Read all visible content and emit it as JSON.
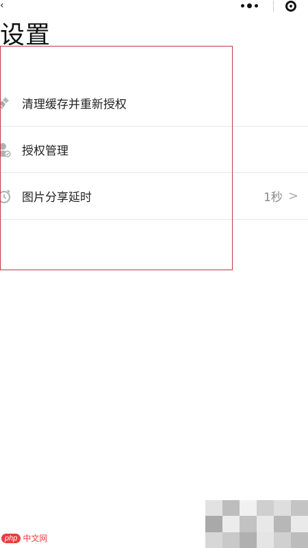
{
  "header": {
    "back_glyph": "‹",
    "title": "设置",
    "capsule": {
      "more_icon": "more-dots-icon",
      "close_icon": "target-close-icon"
    }
  },
  "settings": {
    "items": [
      {
        "label": "清理缓存并重新授权",
        "icon": "broom-icon",
        "value": ""
      },
      {
        "label": "授权管理",
        "icon": "user-shield-icon",
        "value": ""
      },
      {
        "label": "图片分享延时",
        "icon": "alarm-clock-icon",
        "value": "1秒"
      }
    ]
  },
  "watermark": {
    "logo": "php",
    "site": "中文网"
  },
  "colors": {
    "highlight_border": "#c8333f",
    "divider": "#e6e6e6",
    "watermark_red": "#e2211c"
  }
}
